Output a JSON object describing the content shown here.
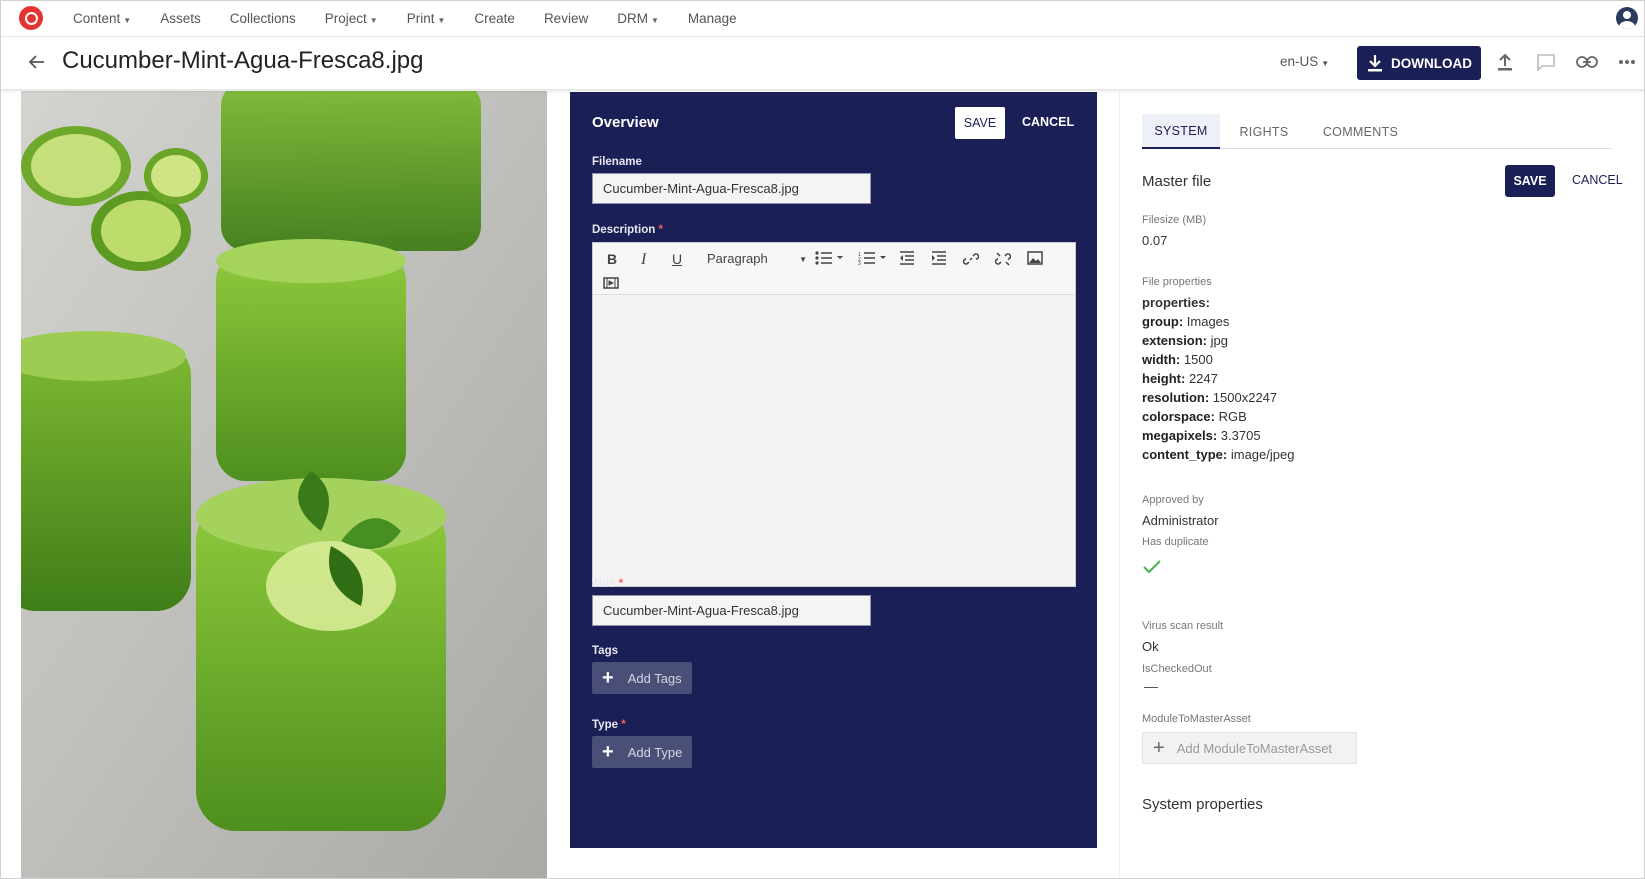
{
  "nav": {
    "items": [
      {
        "label": "Content",
        "dropdown": true
      },
      {
        "label": "Assets",
        "dropdown": false
      },
      {
        "label": "Collections",
        "dropdown": false
      },
      {
        "label": "Project",
        "dropdown": true
      },
      {
        "label": "Print",
        "dropdown": true
      },
      {
        "label": "Create",
        "dropdown": false
      },
      {
        "label": "Review",
        "dropdown": false
      },
      {
        "label": "DRM",
        "dropdown": true
      },
      {
        "label": "Manage",
        "dropdown": false
      }
    ]
  },
  "header": {
    "title": "Cucumber-Mint-Agua-Fresca8.jpg",
    "locale": "en-US",
    "download_label": "DOWNLOAD"
  },
  "overview": {
    "title": "Overview",
    "save_label": "SAVE",
    "cancel_label": "CANCEL",
    "filename_label": "Filename",
    "filename_value": "Cucumber-Mint-Agua-Fresca8.jpg",
    "description_label": "Description",
    "paragraph_label": "Paragraph",
    "title_label": "Title",
    "title_value": "Cucumber-Mint-Agua-Fresca8.jpg",
    "tags_label": "Tags",
    "add_tags_label": "Add Tags",
    "type_label": "Type",
    "add_type_label": "Add Type"
  },
  "right": {
    "tabs": [
      "SYSTEM",
      "RIGHTS",
      "COMMENTS"
    ],
    "active_tab": "SYSTEM",
    "master_file_title": "Master file",
    "save_label": "SAVE",
    "cancel_label": "CANCEL",
    "filesize_label": "Filesize (MB)",
    "filesize_value": "0.07",
    "file_properties_label": "File properties",
    "properties_header": "properties:",
    "properties": [
      {
        "key": "group:",
        "value": "Images"
      },
      {
        "key": "extension:",
        "value": "jpg"
      },
      {
        "key": "width:",
        "value": "1500"
      },
      {
        "key": "height:",
        "value": "2247"
      },
      {
        "key": "resolution:",
        "value": "1500x2247"
      },
      {
        "key": "colorspace:",
        "value": "RGB"
      },
      {
        "key": "megapixels:",
        "value": "3.3705"
      },
      {
        "key": "content_type:",
        "value": "image/jpeg"
      }
    ],
    "approved_by_label": "Approved by",
    "approved_by_value": "Administrator",
    "has_duplicate_label": "Has duplicate",
    "has_duplicate_value": true,
    "virus_scan_label": "Virus scan result",
    "virus_scan_value": "Ok",
    "ischeckedout_label": "IsCheckedOut",
    "module_label": "ModuleToMasterAsset",
    "add_module_label": "Add ModuleToMasterAsset",
    "system_properties_title": "System properties"
  },
  "colors": {
    "navy": "#1a1f55",
    "logo_red": "#e3342f",
    "check_green": "#4caf50",
    "required_red": "#ff5a5a"
  }
}
